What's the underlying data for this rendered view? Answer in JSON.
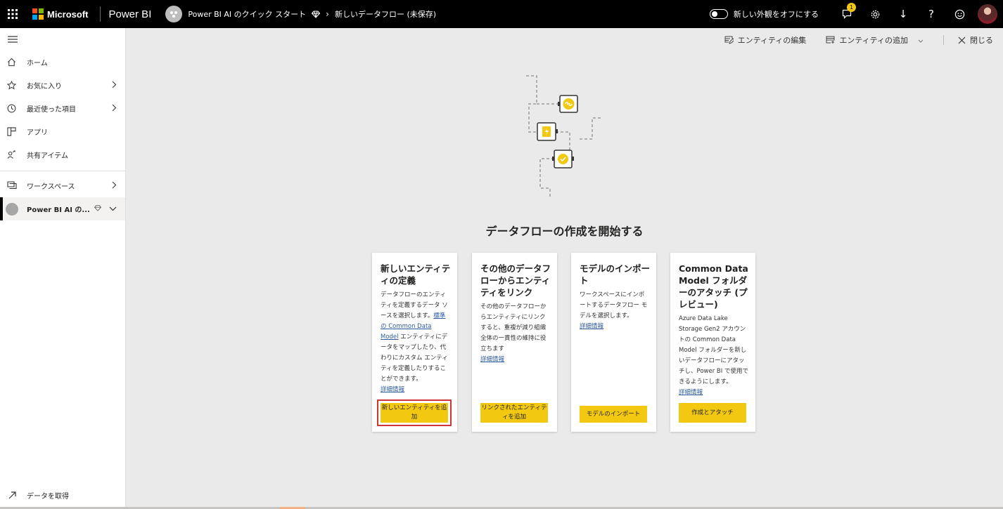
{
  "topbar": {
    "brand": "Microsoft",
    "product": "Power BI",
    "workspace": "Power BI AI のクイック スタート",
    "page": "新しいデータフロー (未保存)",
    "toggle_label": "新しい外観をオフにする",
    "notification_count": "1",
    "help_label": "?",
    "download_label": "↓"
  },
  "sidebar": {
    "items": [
      {
        "label": "ホーム"
      },
      {
        "label": "お気に入り"
      },
      {
        "label": "最近使った項目"
      },
      {
        "label": "アプリ"
      },
      {
        "label": "共有アイテム"
      },
      {
        "label": "ワークスペース"
      },
      {
        "label": "Power BI AI の..."
      }
    ],
    "get_data": "データを取得"
  },
  "commands": {
    "edit_entities": "エンティティの編集",
    "add_entities": "エンティティの追加",
    "close": "閉じる"
  },
  "main": {
    "heading": "データフローの作成を開始する",
    "cards": [
      {
        "title": "新しいエンティティの定義",
        "desc_before": "データフローのエンティティを定義するデータ ソースを選択します。",
        "desc_link": "標準の Common Data Model",
        "desc_after": " エンティティにデータをマップしたり、代わりにカスタム エンティティを定義したりすることができます。",
        "more": "詳細情報",
        "button": "新しいエンティティを追加"
      },
      {
        "title": "その他のデータフローからエンティティをリンク",
        "desc": "その他のデータフローからエンティティにリンクすると、重複が減り組織全体の一貫性の維持に役立ちます",
        "more": "詳細情報",
        "button": "リンクされたエンティティを追加"
      },
      {
        "title": "モデルのインポート",
        "desc": "ワークスペースにインポートするデータフロー モデルを選択します。",
        "more": "詳細情報",
        "button": "モデルのインポート"
      },
      {
        "title": "Common Data Model フォルダーのアタッチ (プレビュー)",
        "desc": "Azure Data Lake Storage Gen2 アカウントの Common Data Model フォルダーを新しいデータフローにアタッチし、Power BI で使用できるようにします。",
        "more": "詳細情報",
        "button": "作成とアタッチ"
      }
    ]
  },
  "colors": {
    "accent_yellow": "#f2c811",
    "highlight_red": "#d13438",
    "topbar_bg": "#000000",
    "link": "#2e5c9e"
  },
  "icons": [
    "waffle-icon",
    "diamond-icon",
    "home-icon",
    "star-icon",
    "clock-icon",
    "apps-icon",
    "shared-icon",
    "workspace-icon",
    "chevron-right-icon",
    "chevron-down-icon",
    "edit-entity-icon",
    "add-entity-icon",
    "close-icon",
    "chat-icon",
    "gear-icon",
    "smiley-icon",
    "arrow-upright-icon"
  ]
}
